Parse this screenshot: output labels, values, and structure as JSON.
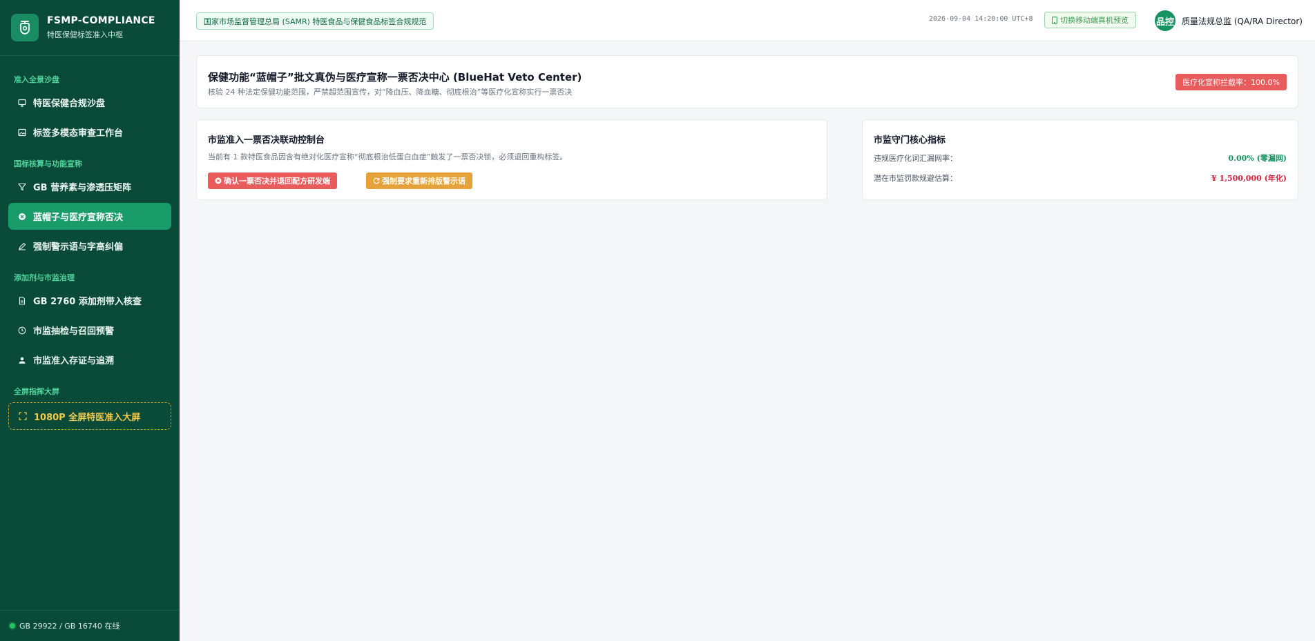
{
  "brand": {
    "title": "FSMP-COMPLIANCE",
    "subtitle": "特医保健标签准入中枢"
  },
  "sidebar": {
    "sections": [
      {
        "label": "准入全景沙盘",
        "items": [
          {
            "label": "特医保健合规沙盘",
            "icon": "monitor-icon"
          },
          {
            "label": "标签多模态审查工作台",
            "icon": "image-icon"
          }
        ]
      },
      {
        "label": "国标核算与功能宣称",
        "items": [
          {
            "label": "GB 营养素与渗透压矩阵",
            "icon": "filter-icon"
          },
          {
            "label": "蓝帽子与医疗宣称否决",
            "icon": "x-circle-icon",
            "active": true
          },
          {
            "label": "强制警示语与字高纠偏",
            "icon": "pen-icon"
          }
        ]
      },
      {
        "label": "添加剂与市监治理",
        "items": [
          {
            "label": "GB 2760 添加剂带入核查",
            "icon": "file-icon"
          },
          {
            "label": "市监抽检与召回预警",
            "icon": "clock-icon"
          },
          {
            "label": "市监准入存证与追溯",
            "icon": "user-icon"
          }
        ]
      },
      {
        "label": "全屏指挥大屏",
        "items": [
          {
            "label": "1080P 全屏特医准入大屏",
            "icon": "expand-icon"
          }
        ]
      }
    ],
    "footer": "GB 29922 / GB 16740 在线"
  },
  "header": {
    "regulation_badge": "国家市场监督管理总局 (SAMR) 特医食品与保健食品标签合规规范",
    "timestamp": "2026-09-04 14:20:00 UTC+8",
    "mobile_preview": "切换移动端真机预览",
    "avatar_text": "品控",
    "user_name": "质量法规总监 (QA/RA Director)"
  },
  "veto_center": {
    "title": "保健功能“蓝帽子”批文真伪与医疗宣称一票否决中心 (BlueHat Veto Center)",
    "description": "核验 24 种法定保健功能范围，严禁超范围宣传，对“降血压、降血糖、彻底根治”等医疗化宣称实行一票否决",
    "rate_label": "医疗化宣称拦截率：100.0%"
  },
  "control_console": {
    "title": "市监准入一票否决联动控制台",
    "description": "当前有 1 款特医食品因含有绝对化医疗宣称“彻底根治低蛋白血症”触发了一票否决锁，必须退回重构标签。",
    "confirm_button": "确认一票否决并退回配方研发端",
    "reprint_button": "强制要求重新排版警示语"
  },
  "metrics": {
    "title": "市监守门核心指标",
    "rows": [
      {
        "label": "违规医疗化词汇漏网率：",
        "value": "0.00% (零漏网)",
        "color": "#15925f"
      },
      {
        "label": "潜在市监罚款规避估算：",
        "value": "¥ 1,500,000 (年化)",
        "color": "#d4213d"
      }
    ]
  },
  "colors": {
    "sidebar_bg": "#0a4a38",
    "accent_green": "#1a9c6a",
    "danger_red": "#ea5c5c",
    "warning_orange": "#e5a23a",
    "bigscreen_gold": "#f2c94c"
  }
}
